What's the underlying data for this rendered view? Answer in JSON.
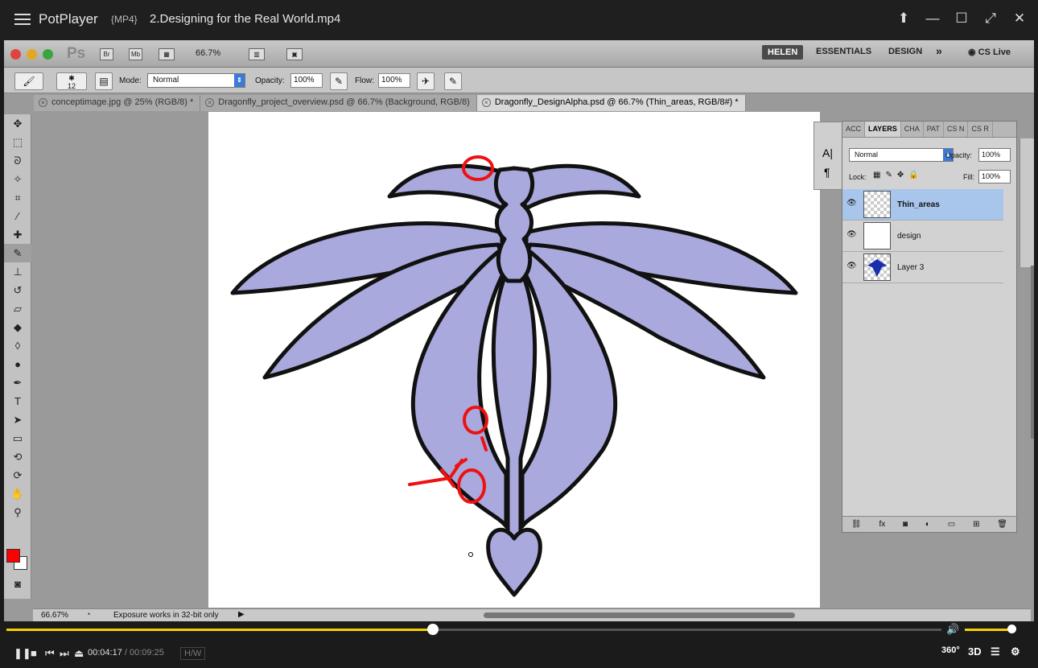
{
  "player": {
    "app_name": "PotPlayer",
    "format": "{MP4}",
    "file_title": "2.Designing for the Real World.mp4",
    "time_current": "00:04:17",
    "time_separator": "/",
    "time_total": "00:09:25",
    "hw_label": "H/W",
    "badge_360": "360°",
    "badge_3d": "3D",
    "seek_progress": 0.456,
    "volume_level": 0.95,
    "accent_color": "#f5d000"
  },
  "photoshop": {
    "logo": "Ps",
    "bridge_label": "Br",
    "minibridge_label": "Mb",
    "zoom": "66.7%",
    "workspaces": [
      "HELEN",
      "ESSENTIALS",
      "DESIGN"
    ],
    "more_symbol": "»",
    "cs_live": "CS Live",
    "options": {
      "brush_size": "12",
      "mode_label": "Mode:",
      "mode_value": "Normal",
      "opacity_label": "Opacity:",
      "opacity_value": "100%",
      "flow_label": "Flow:",
      "flow_value": "100%"
    },
    "tabs": [
      "conceptimage.jpg @ 25% (RGB/8) *",
      "Dragonfly_project_overview.psd @ 66.7% (Background, RGB/8)",
      "Dragonfly_DesignAlpha.psd @ 66.7% (Thin_areas, RGB/8#) *"
    ],
    "foreground_color": "#ff0000",
    "status": {
      "zoom": "66.67%",
      "message": "Exposure works in 32-bit only"
    },
    "layers_panel": {
      "tabs": [
        "ACC",
        "LAYERS",
        "CHA",
        "PAT",
        "CS N",
        "CS R"
      ],
      "blend_mode": "Normal",
      "opacity_label": "Opacity:",
      "opacity_value": "100%",
      "lock_label": "Lock:",
      "fill_label": "Fill:",
      "fill_value": "100%",
      "layers": [
        {
          "name": "Thin_areas",
          "selected": true
        },
        {
          "name": "design",
          "selected": false
        },
        {
          "name": "Layer 3",
          "selected": false
        }
      ]
    },
    "tiny_panel": {
      "char_icon": "A|",
      "para_icon": "¶"
    }
  }
}
